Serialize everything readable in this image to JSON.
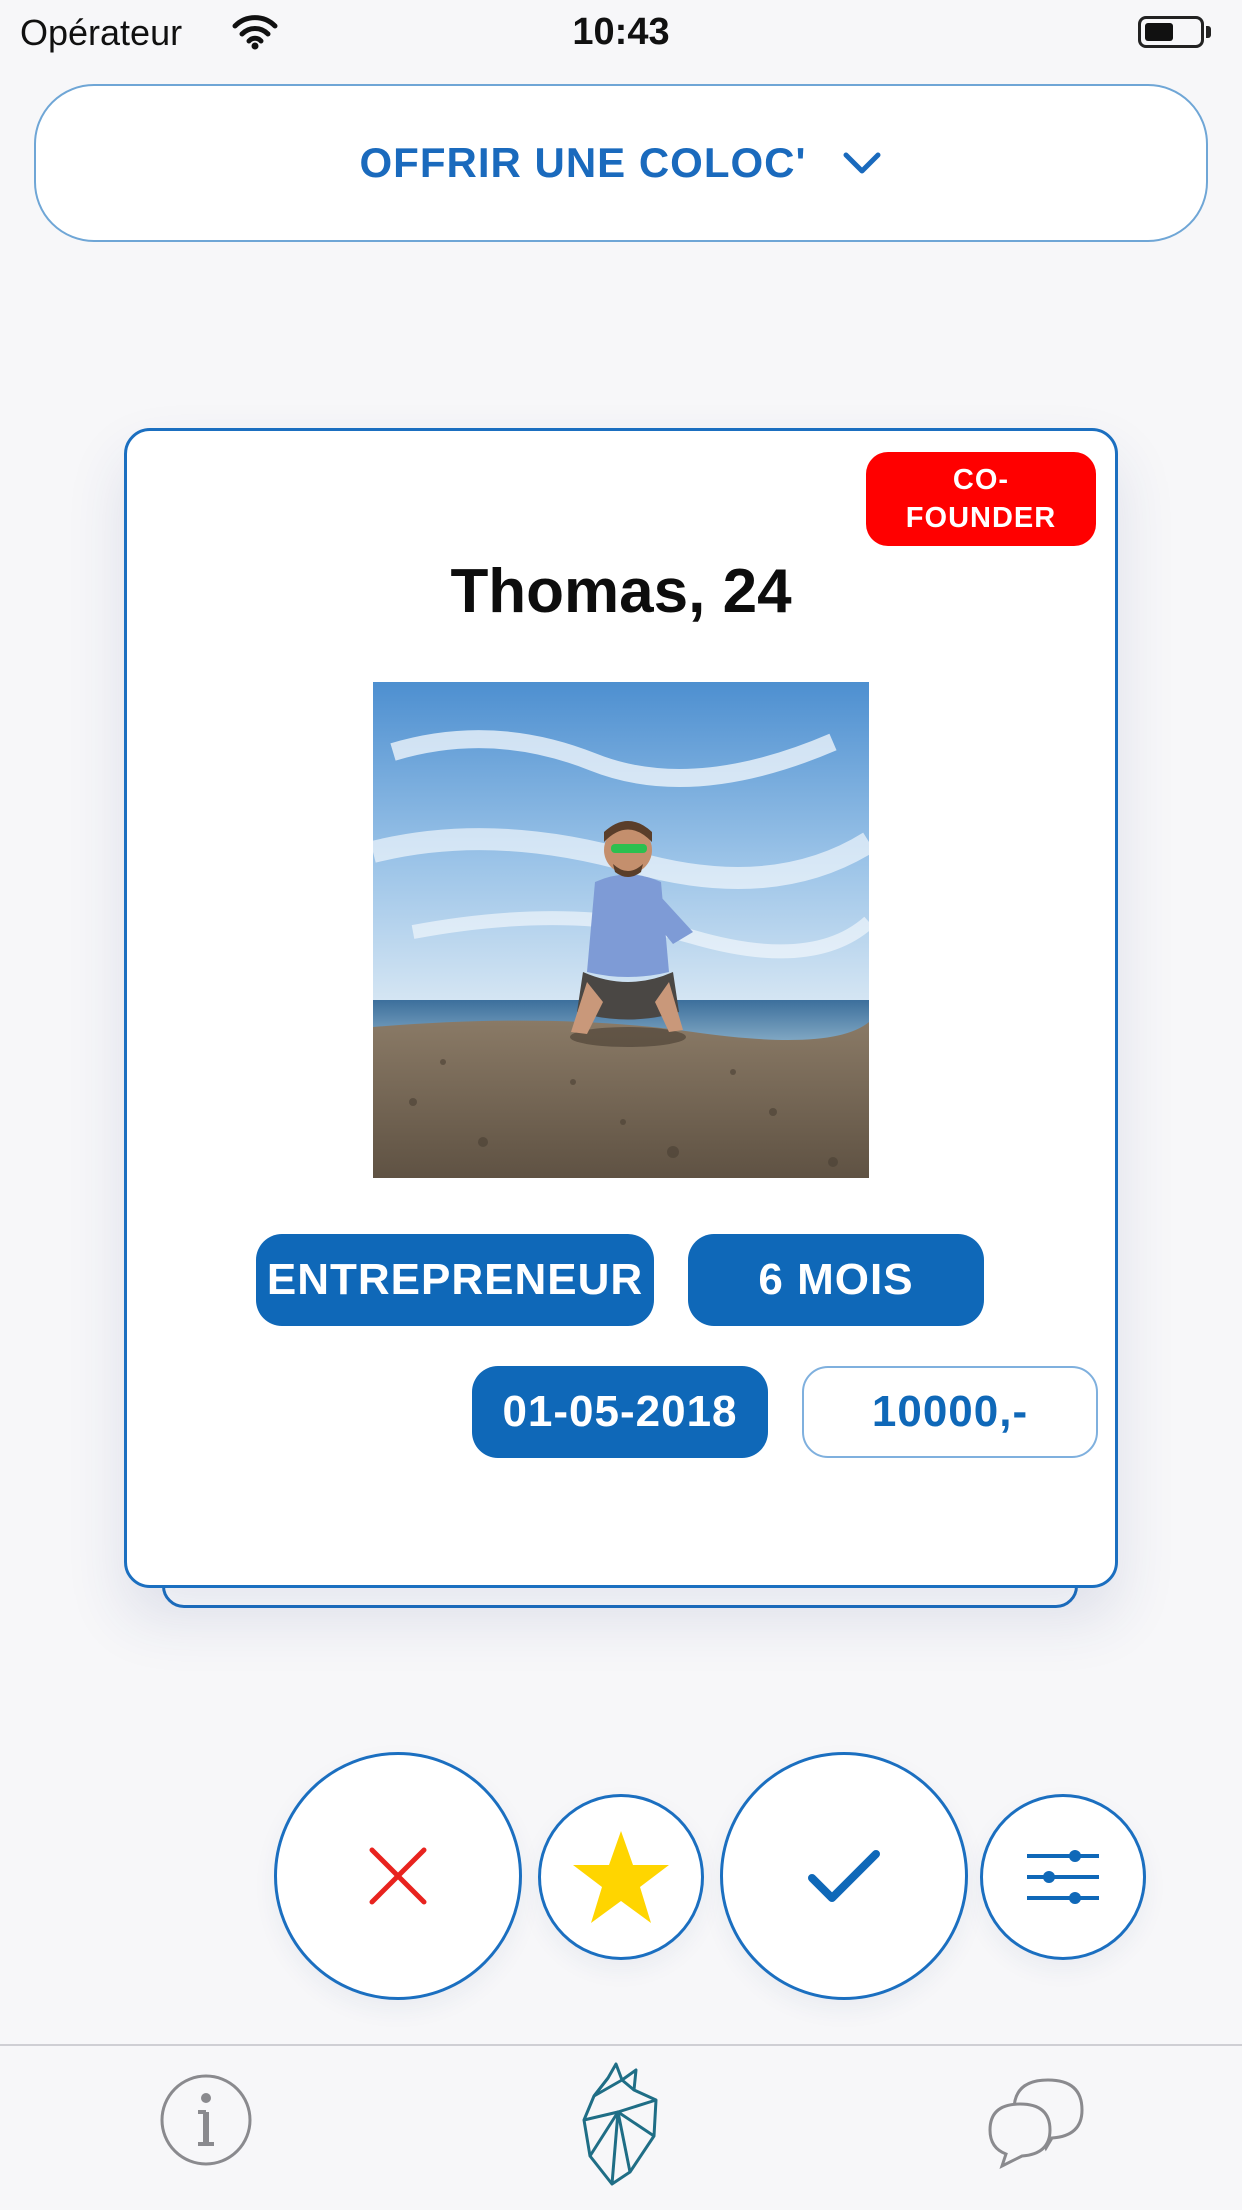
{
  "status_bar": {
    "carrier": "Opérateur",
    "time": "10:43"
  },
  "header": {
    "mode_label": "OFFRIR UNE COLOC'"
  },
  "profile_card": {
    "badge_line1": "CO-",
    "badge_line2": "FOUNDER",
    "name_age": "Thomas, 24",
    "tags": {
      "occupation": "ENTREPRENEUR",
      "duration": "6 MOIS",
      "date": "01-05-2018",
      "price": "10000,-"
    }
  },
  "actions": {
    "reject_icon": "close-icon",
    "favorite_icon": "star-icon",
    "accept_icon": "check-icon",
    "filter_icon": "sliders-icon"
  },
  "tab_bar": {
    "items": [
      "info-icon",
      "heart-logo-icon",
      "chat-icon"
    ]
  },
  "colors": {
    "primary_blue": "#0f68b8",
    "badge_red": "#ff0000",
    "star_yellow": "#ffd500",
    "reject_red": "#e8231f",
    "logo_teal": "#1f6e86"
  }
}
